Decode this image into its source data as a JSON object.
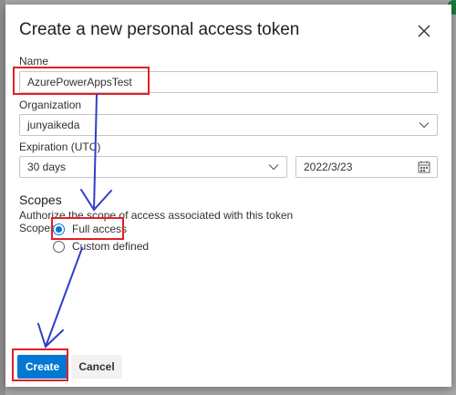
{
  "dialog": {
    "title": "Create a new personal access token",
    "close_icon": "close-icon"
  },
  "name_field": {
    "label": "Name",
    "value": "AzurePowerAppsTest"
  },
  "organization_field": {
    "label": "Organization",
    "value": "junyaikeda",
    "icon": "chevron-down-icon"
  },
  "expiration": {
    "label": "Expiration (UTC)",
    "duration_value": "30 days",
    "duration_icon": "chevron-down-icon",
    "date_value": "2022/3/23",
    "date_icon": "calendar-icon"
  },
  "scopes": {
    "heading": "Scopes",
    "description": "Authorize the scope of access associated with this token",
    "side_label": "Scopes",
    "options": [
      {
        "label": "Full access",
        "selected": true
      },
      {
        "label": "Custom defined",
        "selected": false
      }
    ]
  },
  "footer": {
    "create_label": "Create",
    "cancel_label": "Cancel"
  },
  "colors": {
    "accent": "#0078d4",
    "annotation_red": "#e0202a",
    "annotation_blue": "#2f3fc9"
  }
}
